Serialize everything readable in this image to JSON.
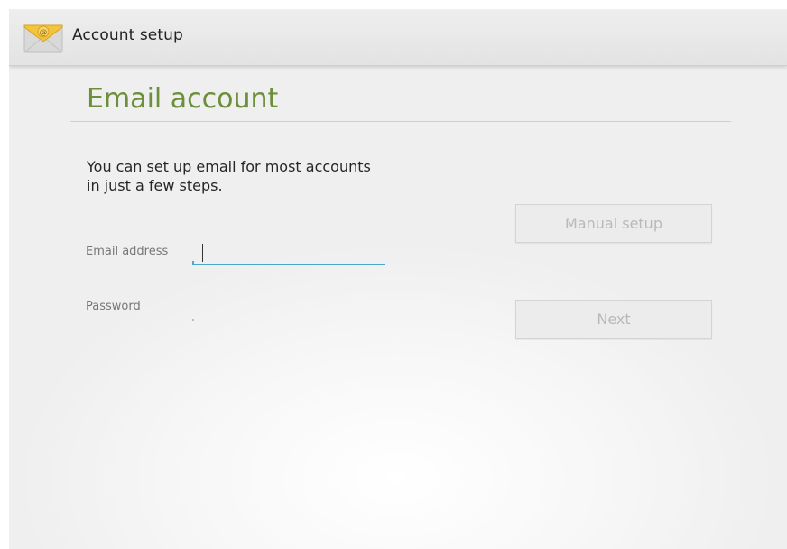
{
  "action_bar": {
    "title": "Account setup",
    "icon": "email-app-icon"
  },
  "heading": "Email account",
  "intro": "You can set up email for most accounts in just a few steps.",
  "fields": {
    "email": {
      "label": "Email address",
      "value": ""
    },
    "password": {
      "label": "Password",
      "value": ""
    }
  },
  "buttons": {
    "manual_setup": "Manual setup",
    "next": "Next"
  },
  "colors": {
    "heading": "#6b8f3a",
    "focus_underline": "#4aa9c9",
    "disabled_text": "#b9b9b9"
  }
}
